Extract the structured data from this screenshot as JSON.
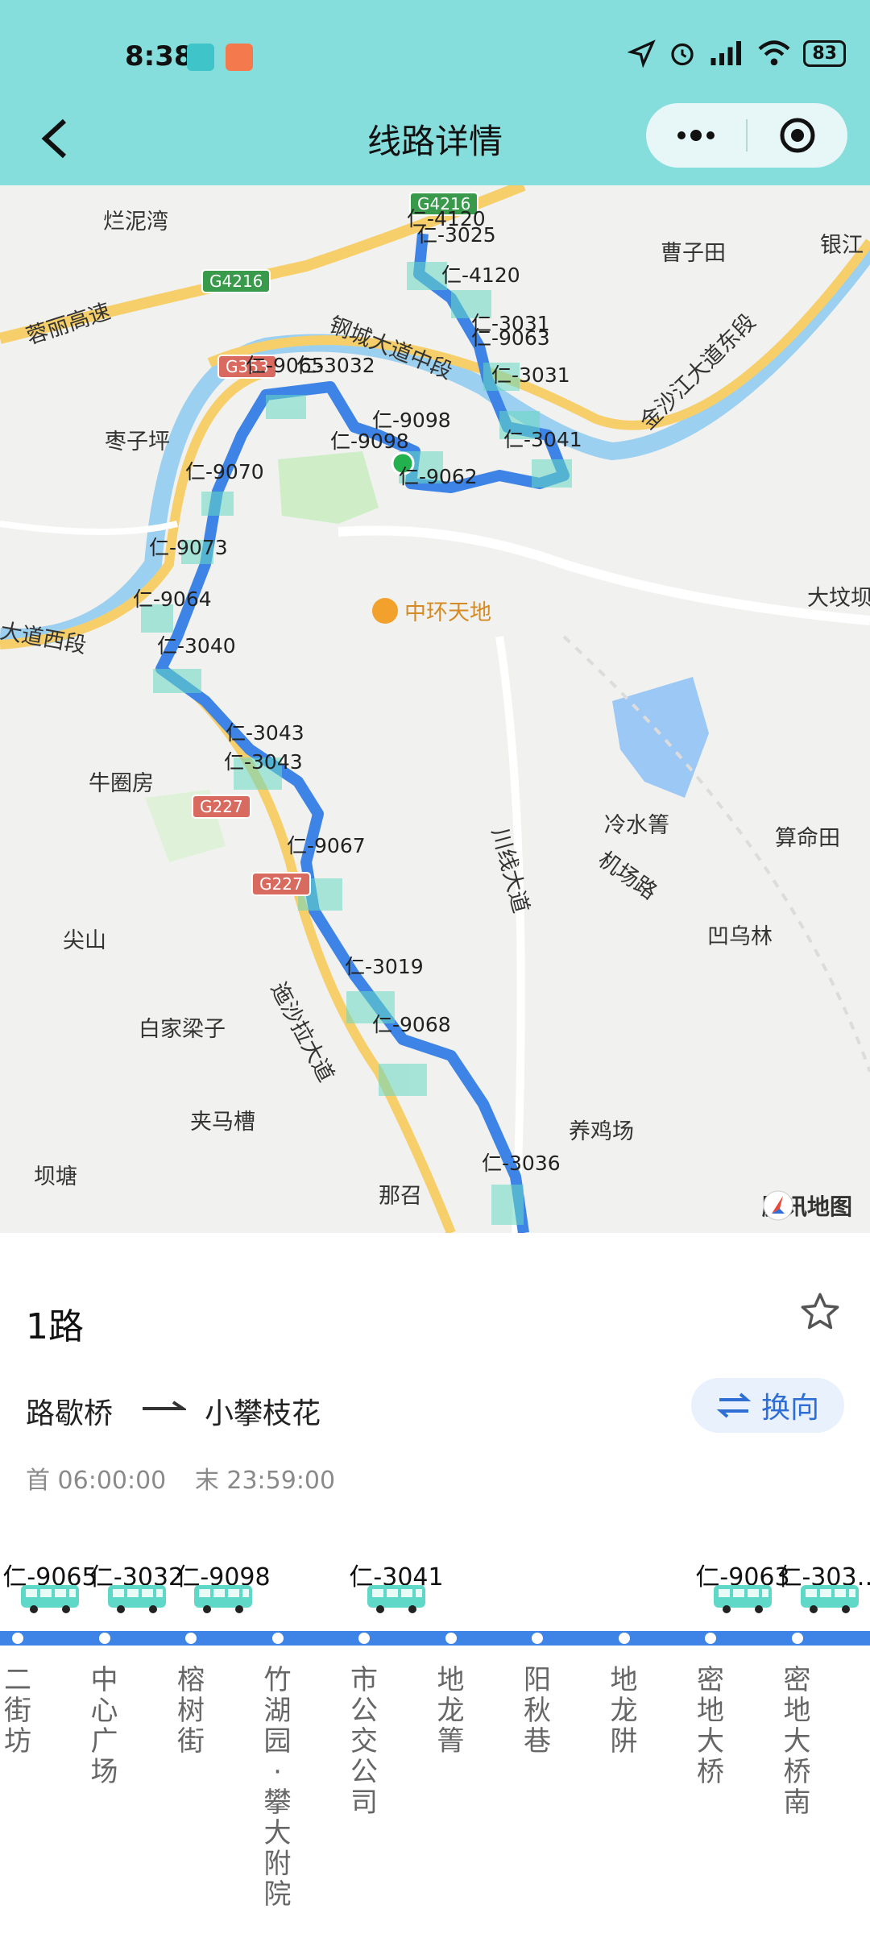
{
  "status_bar": {
    "time": "8:38",
    "battery": "83"
  },
  "header": {
    "title": "线路详情"
  },
  "map": {
    "places": [
      "烂泥湾",
      "蓉丽高速",
      "枣子坪",
      "曹子田",
      "银江",
      "钢城大道中段",
      "金沙江大道东段",
      "大道西段",
      "中环天地",
      "大坟坝",
      "牛圈房",
      "冷水箐",
      "算命田",
      "机场路",
      "凹乌林",
      "尖山",
      "白家梁子",
      "迤沙拉大道",
      "夹马槽",
      "养鸡场",
      "坝塘",
      "那召",
      "川线大道"
    ],
    "shields": [
      "G4216",
      "G4216",
      "G353",
      "G227",
      "G227"
    ],
    "bus_tags": [
      "仁-4120",
      "仁-3025",
      "仁-4120",
      "仁-3031",
      "仁-9063",
      "仁-3031",
      "仁-9065",
      "仁-3032",
      "仁-9098",
      "仁-9098",
      "仁-3041",
      "仁-9062",
      "仁-9070",
      "仁-9073",
      "仁-9064",
      "仁-3040",
      "仁-3043",
      "仁-3043",
      "仁-9067",
      "仁-3019",
      "仁-9068",
      "仁-3036"
    ],
    "watermark": "腾讯地图"
  },
  "route": {
    "name": "1路",
    "from": "路歇桥",
    "to": "小攀枝花",
    "reverse_label": "换向",
    "first_time": "首 06:00:00",
    "last_time": "末 23:59:00"
  },
  "stops": [
    "二街坊",
    "中心广场",
    "榕树街",
    "竹湖园·攀大附院",
    "市公交公司",
    "地龙箐",
    "阳秋巷",
    "地龙阱",
    "密地大桥",
    "密地大桥南"
  ],
  "buses": [
    {
      "id": "仁-9065",
      "stop_index": 0
    },
    {
      "id": "仁-3032",
      "stop_index": 1
    },
    {
      "id": "仁-9098",
      "stop_index": 2
    },
    {
      "id": "仁-3041",
      "stop_index": 4
    },
    {
      "id": "仁-9063",
      "stop_index": 8
    },
    {
      "id": "仁-303…",
      "stop_index": 9
    }
  ],
  "colors": {
    "header_bg": "#86dedc",
    "route_line": "#3d84e6",
    "bus_icon": "#5fd8c7",
    "reverse_bg": "#e8f1fc"
  }
}
